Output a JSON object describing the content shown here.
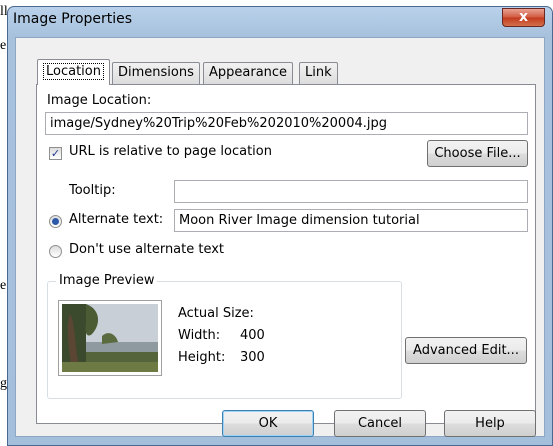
{
  "background": {
    "text_1": "ll",
    "text_2": "e",
    "text_3": "e",
    "text_4": "g"
  },
  "window": {
    "title": "Image Properties",
    "close_glyph": "x"
  },
  "tabs": [
    {
      "label": "Location",
      "active": true
    },
    {
      "label": "Dimensions",
      "active": false
    },
    {
      "label": "Appearance",
      "active": false
    },
    {
      "label": "Link",
      "active": false
    }
  ],
  "location": {
    "image_location_label": "Image Location:",
    "image_location_value": "image/Sydney%20Trip%20Feb%202010%20004.jpg",
    "url_relative_label": "URL is relative to page location",
    "url_relative_checked": true,
    "choose_file_label": "Choose File...",
    "tooltip_label": "Tooltip:",
    "tooltip_value": "",
    "alternate_text_label": "Alternate text:",
    "alternate_text_value": "Moon River Image dimension tutorial",
    "alternate_text_selected": true,
    "no_alt_text_label": "Don't use alternate text"
  },
  "preview": {
    "legend": "Image Preview",
    "actual_size_label": "Actual Size:",
    "width_label": "Width:",
    "width_value": "400",
    "height_label": "Height:",
    "height_value": "300"
  },
  "buttons": {
    "advanced_edit": "Advanced Edit...",
    "ok": "OK",
    "cancel": "Cancel",
    "help": "Help"
  },
  "colors": {
    "title_bar": "#b9d1ea",
    "close_button": "#c8452a",
    "dialog_bg": "#f0f0f0"
  }
}
